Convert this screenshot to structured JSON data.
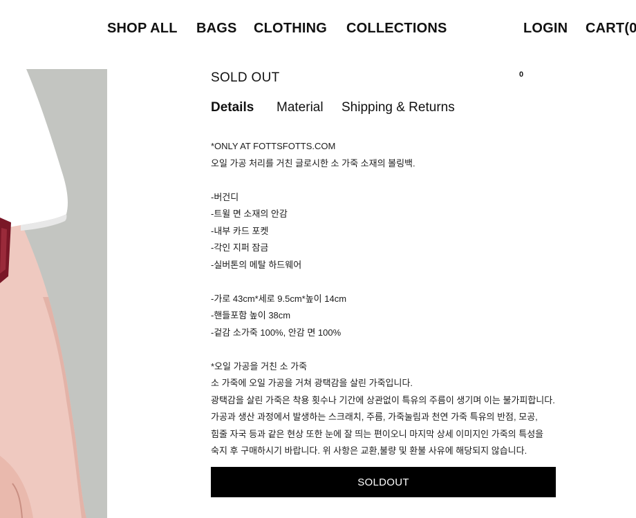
{
  "header": {
    "nav": {
      "shop_all": "SHOP ALL",
      "bags": "BAGS",
      "clothing": "CLOTHING",
      "collections": "COLLECTIONS",
      "login": "LOGIN",
      "cart": "CART(0"
    }
  },
  "product": {
    "stock_status": "SOLD OUT",
    "small_counter": "0",
    "tabs": {
      "details": "Details",
      "material": "Material",
      "shipping": "Shipping & Returns"
    },
    "details_lines": [
      "*ONLY AT FOTTSFOTTS.COM",
      "오일 가공 처리를 거친 글로시한 소 가죽 소재의 볼링백.",
      "",
      "-버건디",
      "-트윌 면 소재의 안감",
      "-내부 카드 포켓",
      "-각인 지퍼 잠금",
      "-실버톤의 메탈 하드웨어",
      "",
      "-가로 43cm*세로 9.5cm*높이 14cm",
      "-핸들포함 높이 38cm",
      "-겉감 소가죽 100%, 안감 면 100%",
      "",
      "*오일 가공을 거친 소 가죽",
      "소 가죽에 오일 가공을 거쳐 광택감을 살린 가죽입니다."
    ],
    "notice_paragraph": "광택감을 살린 가죽은 착용 횟수나 기간에 상관없이 특유의 주름이 생기며 이는 불가피합니다. 가공과 생산 과정에서 발생하는 스크래치, 주름, 가죽눌림과 천연 가죽 특유의 반점, 모공, 힘줄 자국 등과 같은 현상 또한 눈에 잘 띄는 편이오니 마지막 상세 이미지인 가죽의 특성을 숙지 후 구매하시기 바랍니다. 위 사항은 교환,불량 및 환불 사유에 해당되지 않습니다.",
    "soldout_button": "SOLDOUT"
  },
  "colors": {
    "text": "#111111",
    "button_bg": "#000000",
    "button_text": "#ffffff",
    "image_bg": "#c3c5c1"
  }
}
